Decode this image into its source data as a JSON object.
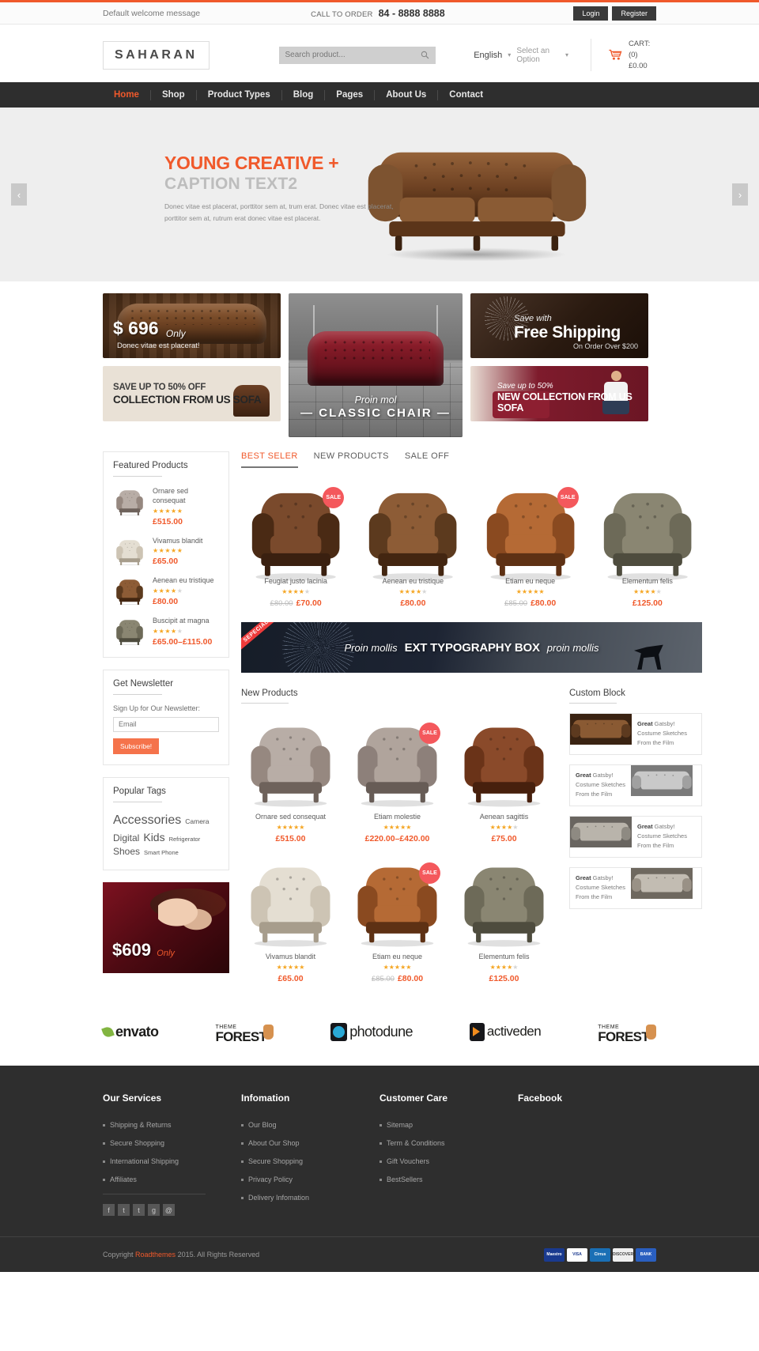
{
  "topbar": {
    "welcome": "Default welcome message",
    "call_label": "CALL TO ORDER",
    "phone": "84 - 8888 8888",
    "login": "Login",
    "register": "Register"
  },
  "header": {
    "logo": "SAHARAN",
    "search_placeholder": "Search product...",
    "search_value": "",
    "language": "English",
    "option": "Select an Option",
    "cart_label": "CART: (0)",
    "cart_total": "£0.00"
  },
  "nav": {
    "items": [
      {
        "label": "Home",
        "active": true
      },
      {
        "label": "Shop",
        "active": false
      },
      {
        "label": "Product Types",
        "active": false
      },
      {
        "label": "Blog",
        "active": false
      },
      {
        "label": "Pages",
        "active": false
      },
      {
        "label": "About Us",
        "active": false
      },
      {
        "label": "Contact",
        "active": false
      }
    ]
  },
  "hero": {
    "heading": "YOUNG CREATIVE +",
    "subheading": "CAPTION TEXT2",
    "paragraph": "Donec vitae est placerat, porttitor sem at, trum erat. Donec vitae est placerat, porttitor sem at, rutrum erat donec vitae est placerat.",
    "prev": "‹",
    "next": "›"
  },
  "promos": {
    "price_banner": {
      "price": "$ 696",
      "only": "Only",
      "sub": "Donec vitae est placerat!"
    },
    "sale_banner": {
      "line1": "SAVE UP TO 50% OFF",
      "line2": "COLLECTION FROM US SOFA"
    },
    "classic": {
      "script": "Proin mol",
      "title": "— CLASSIC CHAIR —"
    },
    "shipping": {
      "script": "Save with",
      "title": "Free Shipping",
      "sub": "On Order Over $200"
    },
    "new_collection": {
      "script": "Save up to 50%",
      "title": "NEW COLLECTION FROM US SOFA"
    }
  },
  "sidebar": {
    "featured_title": "Featured Products",
    "featured": [
      {
        "name": "Ornare sed consequat",
        "stars": 5,
        "price": "£515.00"
      },
      {
        "name": "Vivamus blandit",
        "stars": 5,
        "price": "£65.00"
      },
      {
        "name": "Aenean eu tristique",
        "stars": 4,
        "price": "£80.00"
      },
      {
        "name": "Buscipit at magna",
        "stars": 4,
        "price": "£65.00–£115.00"
      }
    ],
    "newsletter_title": "Get Newsletter",
    "newsletter_label": "Sign Up for Our Newsletter:",
    "newsletter_placeholder": "Email",
    "newsletter_value": "",
    "subscribe_label": "Subscribe!",
    "tags_title": "Popular Tags",
    "tags": [
      {
        "label": "Accessories",
        "size": "t-xl"
      },
      {
        "label": "Camera",
        "size": "t-sm"
      },
      {
        "label": "Digital",
        "size": "t-md"
      },
      {
        "label": "Kids",
        "size": "t-lg"
      },
      {
        "label": "Refrigerator",
        "size": "t-xs"
      },
      {
        "label": "Shoes",
        "size": "t-md"
      },
      {
        "label": "Smart Phone",
        "size": "t-xs"
      }
    ],
    "side_promo": {
      "price": "$609",
      "only": "Only"
    }
  },
  "tabs": [
    {
      "label": "BEST SELER",
      "active": true
    },
    {
      "label": "NEW PRODUCTS",
      "active": false
    },
    {
      "label": "SALE OFF",
      "active": false
    }
  ],
  "best_sellers": [
    {
      "name": "Feugiat justo lacinia",
      "stars": 4,
      "old_price": "£80.00",
      "price": "£70.00",
      "sale": true,
      "art": "wing-brown"
    },
    {
      "name": "Aenean eu tristique",
      "stars": 4,
      "old_price": "",
      "price": "£80.00",
      "sale": false,
      "art": "club-brown"
    },
    {
      "name": "Etiam eu neque",
      "stars": 5,
      "old_price": "£85.00",
      "price": "£80.00",
      "sale": true,
      "art": "tan-chair"
    },
    {
      "name": "Elementum felis",
      "stars": 4,
      "old_price": "",
      "price": "£125.00",
      "sale": false,
      "art": "olive-sofa"
    }
  ],
  "typography_banner": {
    "ribbon": "SEPECIAL",
    "script_left": "Proin mollis",
    "main": "EXT TYPOGRAPHY BOX",
    "script_right": "proin mollis"
  },
  "new_products": {
    "title": "New Products",
    "items": [
      {
        "name": "Ornare sed consequat",
        "stars": 5,
        "old_price": "",
        "price": "£515.00",
        "sale": false,
        "art": "wing-grey"
      },
      {
        "name": "Etiam molestie",
        "stars": 5,
        "old_price": "",
        "price": "£220.00–£420.00",
        "sale": true,
        "art": "wing-grey2"
      },
      {
        "name": "Aenean sagittis",
        "stars": 4,
        "old_price": "",
        "price": "£75.00",
        "sale": false,
        "art": "tub-brown"
      },
      {
        "name": "Vivamus blandit",
        "stars": 5,
        "old_price": "",
        "price": "£65.00",
        "sale": false,
        "art": "cream-chair"
      },
      {
        "name": "Etiam eu neque",
        "stars": 5,
        "old_price": "£85.00",
        "price": "£80.00",
        "sale": true,
        "art": "tan-chair"
      },
      {
        "name": "Elementum felis",
        "stars": 4,
        "old_price": "",
        "price": "£125.00",
        "sale": false,
        "art": "olive-sofa"
      }
    ]
  },
  "custom_block": {
    "title": "Custom Block",
    "items": [
      {
        "bold": "Great",
        "rest": "Gatsby!",
        "line2": "Costume Sketches",
        "line3": "From the Film",
        "image_side": "left",
        "art": "brown-sofa"
      },
      {
        "bold": "Great",
        "rest": "Gatsby!",
        "line2": "Costume Sketches",
        "line3": "From the Film",
        "image_side": "right",
        "art": "grey-sofa"
      },
      {
        "bold": "Great",
        "rest": "Gatsby!",
        "line2": "Costume Sketches",
        "line3": "From the Film",
        "image_side": "left",
        "art": "room"
      },
      {
        "bold": "Great",
        "rest": "Gatsby!",
        "line2": "Costume Sketches",
        "line3": "From the Film",
        "image_side": "right",
        "art": "living"
      }
    ]
  },
  "brands": [
    {
      "name": "envato",
      "type": "envato"
    },
    {
      "name": "THEME FOREST",
      "type": "themeforest"
    },
    {
      "name": "photodune",
      "type": "photodune"
    },
    {
      "name": "activeden",
      "type": "activeden"
    },
    {
      "name": "THEME FOREST",
      "type": "themeforest"
    }
  ],
  "footer": {
    "columns": [
      {
        "title": "Our Services",
        "links": [
          "Shipping & Returns",
          "Secure Shopping",
          "International Shipping",
          "Affiliates"
        ]
      },
      {
        "title": "Infomation",
        "links": [
          "Our Blog",
          "About Our Shop",
          "Secure Shopping",
          "Privacy Policy",
          "Delivery Infomation"
        ]
      },
      {
        "title": "Customer Care",
        "links": [
          "Sitemap",
          "Term & Conditions",
          "Gift Vouchers",
          "BestSellers"
        ]
      },
      {
        "title": "Facebook",
        "links": []
      }
    ],
    "socials": [
      "f",
      "t",
      "t",
      "g",
      "@"
    ],
    "copyright_pre": "Copyright ",
    "copyright_brand": "Roadthemes",
    "copyright_post": " 2015. All Rights Reserved",
    "cards": [
      "Maestro",
      "VISA",
      "Cirrus",
      "DISCOVER",
      "BANK"
    ]
  },
  "colors": {
    "accent": "#f0592b",
    "dark": "#2e2e2e",
    "star_on": "#f5a623",
    "sale": "#f4585c"
  }
}
